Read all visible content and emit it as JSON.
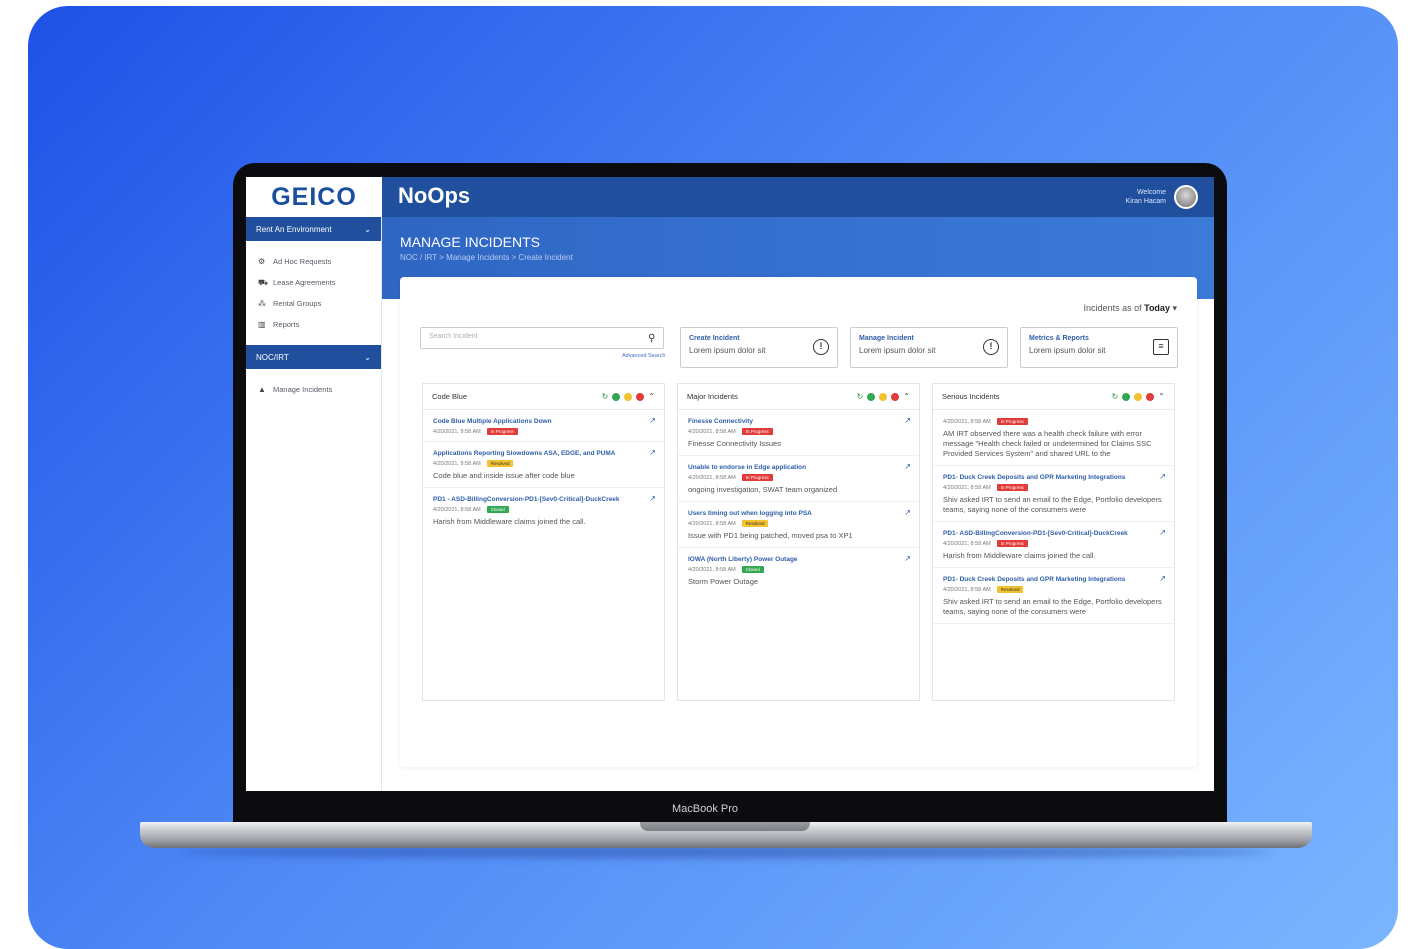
{
  "app": {
    "logo": "GEICO",
    "name": "NoOps",
    "welcome_label": "Welcome",
    "user_name": "Kiran Hacam"
  },
  "device_label": "MacBook Pro",
  "sidebar": {
    "section1": "Rent An Environment",
    "items": [
      {
        "label": "Ad Hoc Requests",
        "icon": "gear-icon"
      },
      {
        "label": "Lease Agreements",
        "icon": "car-icon"
      },
      {
        "label": "Rental Groups",
        "icon": "group-icon"
      },
      {
        "label": "Reports",
        "icon": "chart-icon"
      }
    ],
    "section2": "NOC/IRT",
    "items2": [
      {
        "label": "Manage Incidents",
        "icon": "warning-icon"
      }
    ]
  },
  "banner": {
    "title": "MANAGE INCIDENTS",
    "breadcrumb": "NOC / IRT > Manage Incidents > Create Incident"
  },
  "toolbar": {
    "incidents_as_of": "Incidents as of",
    "as_of_value": "Today",
    "search_placeholder": "Search Incident",
    "advanced_search": "Advanced Search"
  },
  "cards": [
    {
      "title": "Create Incident",
      "desc": "Lorem ipsum dolor sit"
    },
    {
      "title": "Manage Incident",
      "desc": "Lorem ipsum dolor sit"
    },
    {
      "title": "Metrics & Reports",
      "desc": "Lorem ipsum dolor sit"
    }
  ],
  "colors": {
    "red": "#e23b3b",
    "yellow": "#f2c230",
    "green": "#33a852",
    "blue": "#1f4f9d"
  },
  "columns": [
    {
      "title": "Code Blue",
      "incidents": [
        {
          "title": "Code Blue Multiple Applications Down",
          "meta": "4/20/2021, 8:58 AM",
          "status": "In Progress",
          "status_color": "#e23b3b",
          "desc": ""
        },
        {
          "title": "Applications Reporting Slowdowns ASA, EDGE, and PUMA",
          "meta": "4/20/2021, 8:58 AM",
          "status": "Resolved",
          "status_color": "#f2c230",
          "desc": "Code blue and inside issue after code blue"
        },
        {
          "title": "PD1 - ASD-BillingConversion-PD1-[Sev0-Critical]-DuckCreek",
          "meta": "4/20/2021, 8:58 AM",
          "status": "Closed",
          "status_color": "#33a852",
          "desc": "Harish from Middleware claims joined the call."
        }
      ]
    },
    {
      "title": "Major Incidents",
      "incidents": [
        {
          "title": "Finesse Connectivity",
          "meta": "4/20/2021, 8:58 AM",
          "status": "In Progress",
          "status_color": "#e23b3b",
          "desc": "Finesse Connectivity Issues"
        },
        {
          "title": "Unable to endorse in Edge application",
          "meta": "4/20/2021, 8:58 AM",
          "status": "In Progress",
          "status_color": "#e23b3b",
          "desc": "ongoing investigation, SWAT team organized"
        },
        {
          "title": "Users timing out when logging into PSA",
          "meta": "4/20/2021, 8:58 AM",
          "status": "Resolved",
          "status_color": "#f2c230",
          "desc": "Issue with PD1 being patched, moved psa to XP1"
        },
        {
          "title": "IOWA (North Liberty) Power Outage",
          "meta": "4/20/2021, 8:58 AM",
          "status": "Closed",
          "status_color": "#33a852",
          "desc": "Storm Power Outage"
        }
      ]
    },
    {
      "title": "Serious Incidents",
      "incidents": [
        {
          "title": "",
          "meta": "4/20/2021, 8:58 AM",
          "status": "In Progress",
          "status_color": "#e23b3b",
          "desc": "AM IRT observed there was a health check failure with error message \"Health check failed or undetermined for Claims SSC Provided Services System\" and shared URL to the"
        },
        {
          "title": "PD1- Duck Creek Deposits and GPR Marketing Integrations",
          "meta": "4/20/2021, 8:58 AM",
          "status": "In Progress",
          "status_color": "#e23b3b",
          "desc": "Shiv asked IRT to send an email to the Edge, Portfolio developers teams, saying none of the consumers were"
        },
        {
          "title": "PD1- ASD-BillingConversion-PD1-[Sev0-Critical]-DuckCreek",
          "meta": "4/20/2021, 8:58 AM",
          "status": "In Progress",
          "status_color": "#e23b3b",
          "desc": "Harish from Middleware claims joined the call."
        },
        {
          "title": "PD1- Duck Creek Deposits and GPR Marketing Integrations",
          "meta": "4/20/2021, 8:58 AM",
          "status": "Resolved",
          "status_color": "#f2c230",
          "desc": "Shiv asked IRT to send an email to the Edge, Portfolio developers teams, saying none of the consumers were"
        }
      ]
    }
  ]
}
